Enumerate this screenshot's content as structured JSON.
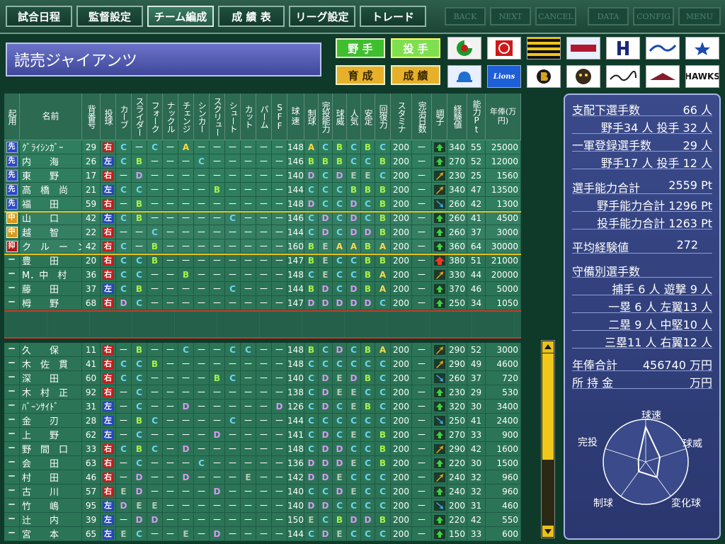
{
  "menu": {
    "items": [
      "試合日程",
      "監督設定",
      "チーム編成",
      "成 績 表",
      "リーグ設定",
      "トレード"
    ],
    "active_index": 2,
    "system": [
      "BACK",
      "NEXT",
      "CANCEL",
      "DATA",
      "CONFIG",
      "MENU"
    ]
  },
  "team": {
    "name": "読売ジャイアンツ"
  },
  "controls": {
    "fielder": "野 手",
    "pitcher": "投 手",
    "develop": "育 成",
    "record": "成 績"
  },
  "logos": [
    "Lions",
    "HAWKS"
  ],
  "table": {
    "headers": [
      "起用",
      "名前",
      "背番号",
      "投球",
      "カーブ",
      "スライダー",
      "フォーク",
      "ナックル",
      "チェンジ",
      "シンカー",
      "スクリュー",
      "シュート",
      "カット",
      "パーム",
      "SFF",
      "球速",
      "制球",
      "完投能力",
      "球威",
      "人気",
      "安定",
      "回復力",
      "スタミナ",
      "完治日数",
      "調子",
      "経験値",
      "能力Pt",
      "年俸(万円)"
    ],
    "rows_top": [
      [
        "先",
        "ｸﾞﾗｲｼﾝｶﾞｰ",
        "29",
        "右",
        "C",
        "ー",
        "C",
        "ー",
        "A",
        "ー",
        "ー",
        "ー",
        "ー",
        "ー",
        "ー",
        "148",
        "A",
        "C",
        "B",
        "C",
        "B",
        "C",
        "200",
        "ー",
        "up",
        "340",
        "55",
        "25000"
      ],
      [
        "先",
        "内　　海",
        "26",
        "左",
        "C",
        "B",
        "ー",
        "ー",
        "ー",
        "C",
        "ー",
        "ー",
        "ー",
        "ー",
        "ー",
        "146",
        "B",
        "B",
        "B",
        "C",
        "C",
        "B",
        "200",
        "ー",
        "up",
        "270",
        "52",
        "12000"
      ],
      [
        "先",
        "東　　野",
        "17",
        "右",
        "ー",
        "D",
        "ー",
        "ー",
        "ー",
        "ー",
        "ー",
        "ー",
        "ー",
        "ー",
        "ー",
        "140",
        "D",
        "C",
        "D",
        "E",
        "E",
        "C",
        "200",
        "ー",
        "upright",
        "230",
        "25",
        "1560"
      ],
      [
        "先",
        "高　橋　尚",
        "21",
        "左",
        "C",
        "C",
        "ー",
        "ー",
        "ー",
        "ー",
        "B",
        "ー",
        "ー",
        "ー",
        "ー",
        "144",
        "C",
        "C",
        "C",
        "B",
        "B",
        "B",
        "200",
        "ー",
        "upright",
        "340",
        "47",
        "13500"
      ],
      [
        "先",
        "福　　田",
        "59",
        "右",
        "ー",
        "B",
        "ー",
        "ー",
        "ー",
        "ー",
        "ー",
        "ー",
        "ー",
        "ー",
        "ー",
        "148",
        "D",
        "C",
        "C",
        "D",
        "C",
        "B",
        "200",
        "ー",
        "downright",
        "260",
        "42",
        "1300"
      ],
      [
        "中",
        "山　　口",
        "42",
        "左",
        "C",
        "B",
        "ー",
        "ー",
        "ー",
        "ー",
        "ー",
        "C",
        "ー",
        "ー",
        "ー",
        "146",
        "C",
        "D",
        "C",
        "D",
        "C",
        "B",
        "200",
        "ー",
        "up",
        "260",
        "41",
        "4500"
      ],
      [
        "中",
        "越　　智",
        "22",
        "右",
        "ー",
        "ー",
        "C",
        "ー",
        "ー",
        "ー",
        "ー",
        "ー",
        "ー",
        "ー",
        "ー",
        "144",
        "C",
        "D",
        "C",
        "D",
        "D",
        "B",
        "200",
        "ー",
        "up",
        "260",
        "37",
        "3000"
      ],
      [
        "抑",
        "ク　ル　ー　ン",
        "42",
        "右",
        "C",
        "ー",
        "B",
        "ー",
        "ー",
        "ー",
        "ー",
        "ー",
        "ー",
        "ー",
        "ー",
        "160",
        "B",
        "E",
        "A",
        "A",
        "B",
        "A",
        "200",
        "ー",
        "up",
        "360",
        "64",
        "30000"
      ],
      [
        "ー",
        "豊　　田",
        "20",
        "右",
        "C",
        "C",
        "B",
        "ー",
        "ー",
        "ー",
        "ー",
        "ー",
        "ー",
        "ー",
        "ー",
        "147",
        "B",
        "E",
        "C",
        "C",
        "B",
        "B",
        "200",
        "ー",
        "upbig",
        "380",
        "51",
        "21000"
      ],
      [
        "ー",
        "M．中　村",
        "36",
        "右",
        "C",
        "C",
        "ー",
        "ー",
        "B",
        "ー",
        "ー",
        "ー",
        "ー",
        "ー",
        "ー",
        "148",
        "C",
        "E",
        "C",
        "C",
        "B",
        "A",
        "200",
        "ー",
        "upright",
        "330",
        "44",
        "20000"
      ],
      [
        "ー",
        "藤　　田",
        "37",
        "左",
        "C",
        "B",
        "ー",
        "ー",
        "ー",
        "ー",
        "ー",
        "C",
        "ー",
        "ー",
        "ー",
        "144",
        "B",
        "D",
        "C",
        "D",
        "B",
        "A",
        "200",
        "ー",
        "up",
        "370",
        "46",
        "5000"
      ],
      [
        "ー",
        "栂　　野",
        "68",
        "右",
        "D",
        "C",
        "ー",
        "ー",
        "ー",
        "ー",
        "ー",
        "ー",
        "ー",
        "ー",
        "ー",
        "147",
        "D",
        "D",
        "D",
        "D",
        "D",
        "C",
        "200",
        "ー",
        "up",
        "250",
        "34",
        "1050"
      ]
    ],
    "rows_bottom": [
      [
        "ー",
        "久　　保",
        "11",
        "右",
        "ー",
        "B",
        "ー",
        "ー",
        "C",
        "ー",
        "ー",
        "C",
        "C",
        "ー",
        "ー",
        "148",
        "B",
        "C",
        "D",
        "C",
        "B",
        "A",
        "200",
        "ー",
        "upright",
        "290",
        "52",
        "3000"
      ],
      [
        "ー",
        "木　佐　貫",
        "41",
        "右",
        "C",
        "C",
        "B",
        "ー",
        "ー",
        "ー",
        "ー",
        "ー",
        "ー",
        "ー",
        "ー",
        "148",
        "C",
        "C",
        "C",
        "C",
        "C",
        "C",
        "200",
        "ー",
        "upright",
        "290",
        "49",
        "4600"
      ],
      [
        "ー",
        "深　　田",
        "60",
        "右",
        "C",
        "C",
        "ー",
        "ー",
        "ー",
        "ー",
        "B",
        "C",
        "ー",
        "ー",
        "ー",
        "140",
        "C",
        "D",
        "E",
        "D",
        "B",
        "C",
        "200",
        "ー",
        "downright",
        "260",
        "37",
        "720"
      ],
      [
        "ー",
        "木　村　正",
        "92",
        "右",
        "ー",
        "C",
        "ー",
        "ー",
        "ー",
        "ー",
        "ー",
        "ー",
        "ー",
        "ー",
        "ー",
        "138",
        "C",
        "D",
        "E",
        "E",
        "C",
        "C",
        "200",
        "ー",
        "up",
        "230",
        "29",
        "530"
      ],
      [
        "ー",
        "ﾊﾞｰﾝｻｲﾄﾞ",
        "31",
        "左",
        "ー",
        "C",
        "ー",
        "ー",
        "D",
        "ー",
        "ー",
        "ー",
        "ー",
        "ー",
        "D",
        "126",
        "C",
        "D",
        "C",
        "E",
        "B",
        "C",
        "200",
        "ー",
        "up",
        "320",
        "30",
        "3400"
      ],
      [
        "ー",
        "金　　刃",
        "28",
        "左",
        "ー",
        "B",
        "C",
        "ー",
        "ー",
        "ー",
        "ー",
        "C",
        "ー",
        "ー",
        "ー",
        "144",
        "C",
        "C",
        "C",
        "C",
        "C",
        "C",
        "200",
        "ー",
        "downright",
        "250",
        "41",
        "2400"
      ],
      [
        "ー",
        "上　　野",
        "62",
        "左",
        "ー",
        "C",
        "ー",
        "ー",
        "ー",
        "ー",
        "D",
        "ー",
        "ー",
        "ー",
        "ー",
        "141",
        "C",
        "D",
        "C",
        "E",
        "C",
        "B",
        "200",
        "ー",
        "up",
        "270",
        "33",
        "900"
      ],
      [
        "ー",
        "野　間　口",
        "33",
        "右",
        "C",
        "B",
        "C",
        "ー",
        "D",
        "ー",
        "ー",
        "ー",
        "ー",
        "ー",
        "ー",
        "148",
        "C",
        "D",
        "D",
        "C",
        "C",
        "B",
        "200",
        "ー",
        "upright",
        "290",
        "42",
        "1600"
      ],
      [
        "ー",
        "会　　田",
        "63",
        "右",
        "ー",
        "C",
        "ー",
        "ー",
        "ー",
        "C",
        "ー",
        "ー",
        "ー",
        "ー",
        "ー",
        "136",
        "D",
        "D",
        "D",
        "E",
        "C",
        "B",
        "200",
        "ー",
        "up",
        "220",
        "30",
        "1500"
      ],
      [
        "ー",
        "村　　田",
        "46",
        "右",
        "ー",
        "D",
        "ー",
        "ー",
        "D",
        "ー",
        "ー",
        "ー",
        "E",
        "ー",
        "ー",
        "142",
        "D",
        "D",
        "E",
        "C",
        "C",
        "C",
        "200",
        "ー",
        "upright",
        "240",
        "32",
        "960"
      ],
      [
        "ー",
        "古　　川",
        "57",
        "右",
        "E",
        "D",
        "ー",
        "ー",
        "ー",
        "ー",
        "D",
        "ー",
        "ー",
        "ー",
        "ー",
        "140",
        "C",
        "C",
        "D",
        "E",
        "C",
        "C",
        "200",
        "ー",
        "up",
        "240",
        "32",
        "960"
      ],
      [
        "ー",
        "竹　　嶋",
        "95",
        "左",
        "D",
        "E",
        "E",
        "ー",
        "ー",
        "ー",
        "ー",
        "ー",
        "ー",
        "ー",
        "ー",
        "140",
        "D",
        "D",
        "C",
        "C",
        "C",
        "C",
        "200",
        "ー",
        "downright",
        "200",
        "31",
        "460"
      ],
      [
        "ー",
        "辻　　内",
        "39",
        "左",
        "ー",
        "D",
        "D",
        "ー",
        "ー",
        "ー",
        "ー",
        "ー",
        "ー",
        "ー",
        "ー",
        "150",
        "E",
        "C",
        "B",
        "D",
        "D",
        "B",
        "200",
        "ー",
        "up",
        "220",
        "42",
        "550"
      ],
      [
        "ー",
        "宮　　本",
        "65",
        "左",
        "E",
        "C",
        "ー",
        "ー",
        "E",
        "ー",
        "D",
        "ー",
        "ー",
        "ー",
        "ー",
        "144",
        "C",
        "D",
        "E",
        "C",
        "C",
        "C",
        "200",
        "ー",
        "up",
        "150",
        "33",
        "600"
      ]
    ]
  },
  "summary": {
    "l1": "支配下選手数",
    "v1": "66 人",
    "l2": "野手34 人 投手 32 人",
    "l3": "一軍登録選手数",
    "v3": "29 人",
    "l4": "野手17 人 投手 12 人",
    "l5": "選手能力合計",
    "v5": "2559 Pt",
    "l6": "野手能力合計 1296 Pt",
    "l7": "投手能力合計 1263 Pt",
    "l8": "平均経験値",
    "v8": "272",
    "l9": "守備別選手数",
    "l10": "捕手 6 人 遊撃 9 人",
    "l11": "一塁 6 人 左翼13 人",
    "l12": "二塁 9 人 中堅10 人",
    "l13": "三塁11 人 右翼12 人",
    "l14": "年俸合計",
    "v14": "456740 万円",
    "l15": "所 持 金",
    "v15": "万円"
  },
  "radar": {
    "labels": [
      "球速",
      "球威",
      "変化球",
      "制球",
      "完投"
    ],
    "values": [
      0.82,
      0.35,
      0.45,
      0.28,
      0.18
    ]
  }
}
